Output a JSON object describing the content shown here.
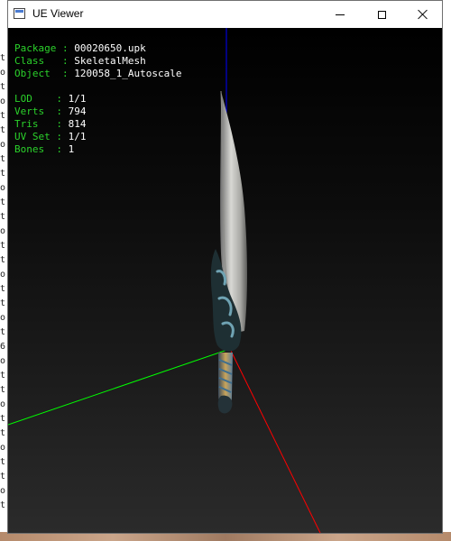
{
  "window": {
    "title": "UE Viewer"
  },
  "info_block_1": [
    {
      "label": "Package",
      "value": "00020650.upk"
    },
    {
      "label": "Class  ",
      "value": "SkeletalMesh"
    },
    {
      "label": "Object ",
      "value": "120058_1_Autoscale"
    }
  ],
  "info_block_2": [
    {
      "label": "LOD   ",
      "value": "1/1"
    },
    {
      "label": "Verts ",
      "value": "794"
    },
    {
      "label": "Tris  ",
      "value": "814"
    },
    {
      "label": "UV Set",
      "value": "1/1"
    },
    {
      "label": "Bones ",
      "value": "1"
    }
  ],
  "axis_colors": {
    "x": "#ff0000",
    "y": "#00ff00",
    "z": "#0000ff"
  },
  "background_console_chars": [
    "t",
    "o",
    "t",
    "o",
    "t",
    "t",
    "o",
    "t",
    "t",
    "o",
    "t",
    "t",
    "o",
    "t",
    "t",
    "o",
    "t",
    "t",
    "o",
    "t",
    "6",
    "o",
    "t",
    "t",
    "o",
    "t",
    "t",
    "o",
    "t",
    "t",
    "o",
    "t"
  ]
}
